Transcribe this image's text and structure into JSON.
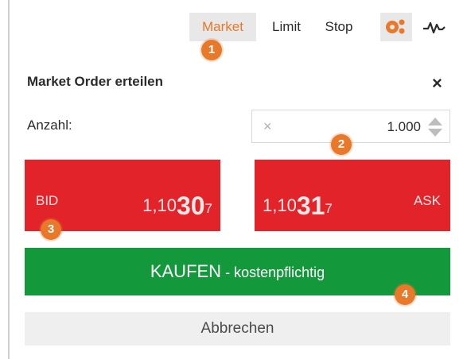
{
  "toolbar": {
    "tabs": [
      {
        "label": "Market",
        "active": true
      },
      {
        "label": "Limit",
        "active": false
      },
      {
        "label": "Stop",
        "active": false
      }
    ],
    "icons": [
      "order-type-icon",
      "chart-pulse-icon"
    ]
  },
  "dialog": {
    "title": "Market Order erteilen",
    "close_glyph": "×"
  },
  "quantity": {
    "label": "Anzahl:",
    "clear_glyph": "×",
    "value": "1.000"
  },
  "bid": {
    "label": "BID",
    "price_main": "1,10",
    "price_big": "30",
    "price_pip": "7"
  },
  "ask": {
    "label": "ASK",
    "price_main": "1,10",
    "price_big": "31",
    "price_pip": "7"
  },
  "buy_button": {
    "main": "KAUFEN",
    "sep": " - ",
    "sub": "kostenpflichtig"
  },
  "cancel_button": {
    "label": "Abbrechen"
  },
  "badges": [
    "1",
    "2",
    "3",
    "4"
  ],
  "colors": {
    "accent": "#e8782a",
    "bid_ask": "#e2242a",
    "buy": "#13983c",
    "cancel": "#efefef"
  }
}
